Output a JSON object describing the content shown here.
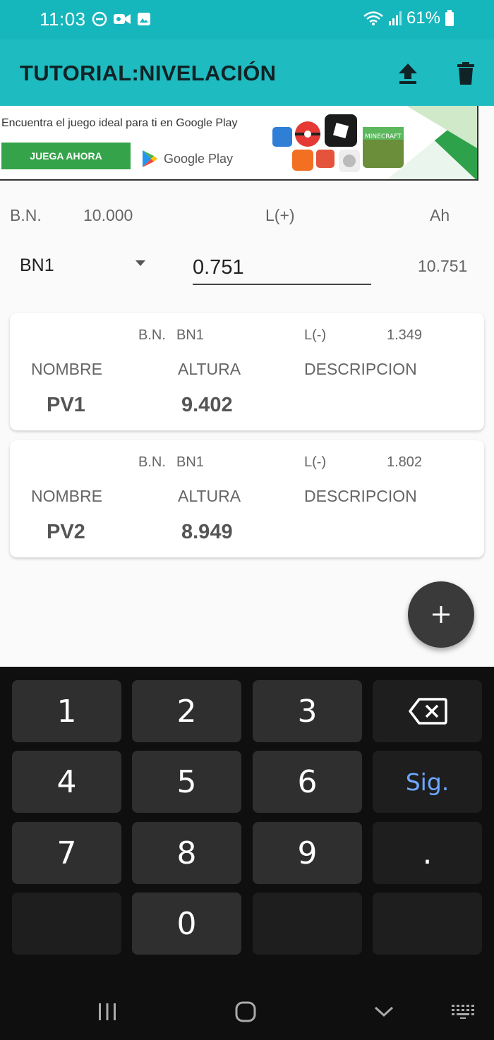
{
  "status_bar": {
    "time": "11:03",
    "battery": "61%"
  },
  "app_bar": {
    "title": "TUTORIAL:NIVELACIÓN"
  },
  "ad": {
    "headline": "Encuentra el juego ideal para ti en Google Play",
    "cta": "JUEGA AHORA",
    "store": "Google Play"
  },
  "header": {
    "bn_label": "B.N.",
    "bn_value": "10.000",
    "lplus_label": "L(+)",
    "ah_label": "Ah",
    "bn_selected": "BN1",
    "reading": "0.751",
    "ah_value": "10.751"
  },
  "cards": [
    {
      "bn_label": "B.N.",
      "bn": "BN1",
      "lminus_label": "L(-)",
      "lminus": "1.349",
      "col_name": "NOMBRE",
      "col_alt": "ALTURA",
      "col_desc": "DESCRIPCION",
      "name": "PV1",
      "altura": "9.402"
    },
    {
      "bn_label": "B.N.",
      "bn": "BN1",
      "lminus_label": "L(-)",
      "lminus": "1.802",
      "col_name": "NOMBRE",
      "col_alt": "ALTURA",
      "col_desc": "DESCRIPCION",
      "name": "PV2",
      "altura": "8.949"
    }
  ],
  "fab": {
    "label": "+"
  },
  "keyboard": {
    "keys": [
      "1",
      "2",
      "3",
      "4",
      "5",
      "6",
      "Sig.",
      "7",
      "8",
      "9",
      ".",
      "0"
    ]
  },
  "colors": {
    "status_bar": "#16b6bd",
    "app_bar": "#1ebcc0",
    "keyboard_bg": "#0f0f0f",
    "key_bg": "#2f2f2f",
    "accent_blue": "#6ea8ff"
  },
  "icons": [
    "dnd-icon",
    "video-icon",
    "image-icon",
    "wifi-icon",
    "signal-icon",
    "battery-icon",
    "upload-icon",
    "trash-icon",
    "dropdown-arrow-icon",
    "plus-icon",
    "backspace-icon",
    "recents-icon",
    "home-icon",
    "back-icon",
    "keyboard-icon"
  ]
}
